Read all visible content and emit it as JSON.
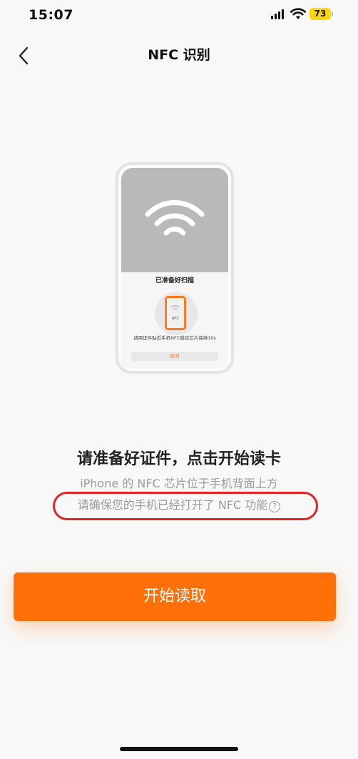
{
  "status_bar": {
    "time": "15:07",
    "battery": "73",
    "icons": [
      "signal-icon",
      "wifi-icon",
      "battery-icon"
    ]
  },
  "nav": {
    "title": "NFC 识别",
    "back_icon": "chevron-left-icon"
  },
  "illustration": {
    "ready_text": "已准备好扫描",
    "phone_label": "NFC",
    "hint": "请用证件贴近手机NFC感应芯片保持10s",
    "cancel": "取消"
  },
  "content": {
    "headline": "请准备好证件，点击开始读卡",
    "line1": "iPhone 的 NFC 芯片位于手机背面上方",
    "line2": "请确保您的手机已经打开了 NFC 功能",
    "help_glyph": "?"
  },
  "primary_button": {
    "label": "开始读取"
  },
  "colors": {
    "accent": "#ff7009",
    "annotation": "#e02424",
    "battery": "#ffd60a"
  }
}
